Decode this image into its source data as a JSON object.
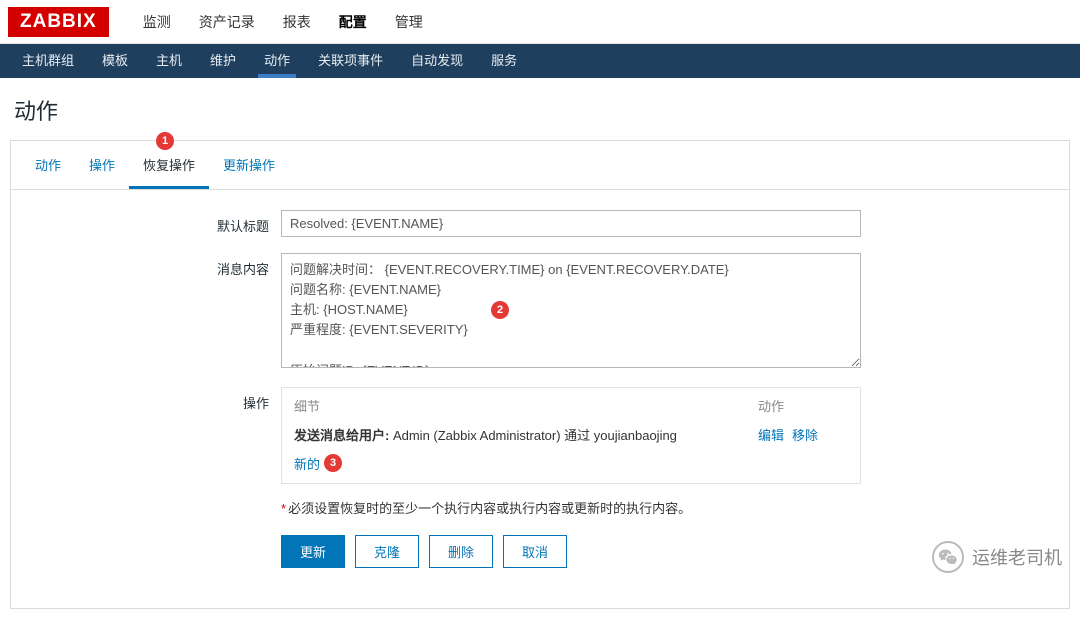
{
  "logo": "ZABBIX",
  "topnav": {
    "items": [
      "监测",
      "资产记录",
      "报表",
      "配置",
      "管理"
    ],
    "active_index": 3
  },
  "subnav": {
    "items": [
      "主机群组",
      "模板",
      "主机",
      "维护",
      "动作",
      "关联项事件",
      "自动发现",
      "服务"
    ],
    "active_index": 4
  },
  "page_title": "动作",
  "tabs": {
    "items": [
      "动作",
      "操作",
      "恢复操作",
      "更新操作"
    ],
    "active_index": 2
  },
  "form": {
    "default_title_label": "默认标题",
    "default_title_value": "Resolved: {EVENT.NAME}",
    "message_label": "消息内容",
    "message_value": "问题解决时间： {EVENT.RECOVERY.TIME} on {EVENT.RECOVERY.DATE}\n问题名称: {EVENT.NAME}\n主机: {HOST.NAME}\n严重程度: {EVENT.SEVERITY}\n\n原始问题ID: {EVENT.ID}\n{TRIGGER.URL}",
    "operations_label": "操作",
    "ops_header_detail": "细节",
    "ops_header_action": "动作",
    "ops_row_prefix": "发送消息给用户:",
    "ops_row_suffix": " Admin (Zabbix Administrator) 通过 youjianbaojing",
    "ops_edit": "编辑",
    "ops_remove": "移除",
    "ops_new": "新的",
    "hint": "必须设置恢复时的至少一个执行内容或执行内容或更新时的执行内容。"
  },
  "buttons": {
    "update": "更新",
    "clone": "克隆",
    "delete": "删除",
    "cancel": "取消"
  },
  "annotations": {
    "a1": "1",
    "a2": "2",
    "a3": "3"
  },
  "watermark": "运维老司机"
}
